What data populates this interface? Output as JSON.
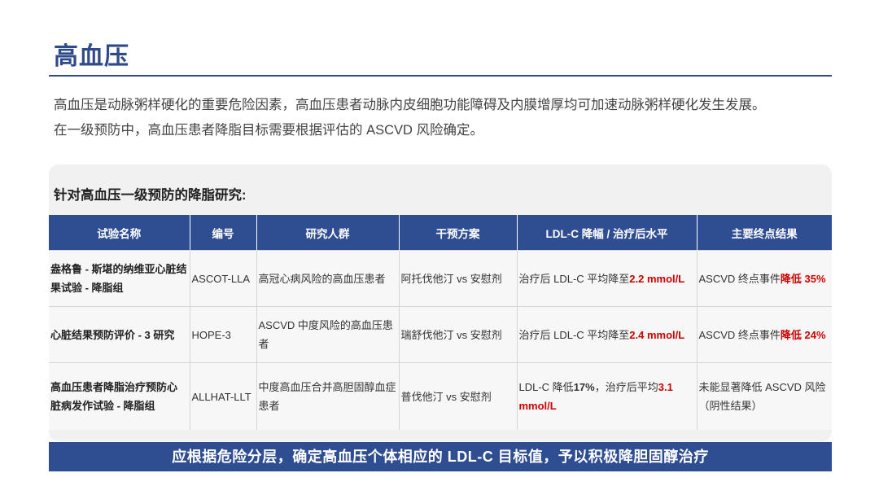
{
  "page": {
    "title": "高血压",
    "intro": [
      "高血压是动脉粥样硬化的重要危险因素，高血压患者动脉内皮细胞功能障碍及内膜增厚均可加速动脉粥样硬化发生发展。",
      "在一级预防中，高血压患者降脂目标需要根据评估的 ASCVD 风险确定。"
    ]
  },
  "panel": {
    "heading": "针对高血压一级预防的降脂研究:"
  },
  "table": {
    "headers": [
      "试验名称",
      "编号",
      "研究人群",
      "干预方案",
      "LDL-C 降幅 / 治疗后水平",
      "主要终点结果"
    ],
    "rows": [
      {
        "name": "盎格鲁 - 斯堪的纳维亚心脏结果试验 - 降脂组",
        "code": "ASCOT-LLA",
        "population": "高冠心病风险的高血压患者",
        "intervention": "阿托伐他汀 vs 安慰剂",
        "ldl_prefix": "治疗后 LDL-C 平均降至",
        "ldl_value": "2.2 mmol/L",
        "endpoint_prefix": "ASCVD 终点事件",
        "endpoint_value": "降低 35%"
      },
      {
        "name": "心脏结果预防评价 - 3 研究",
        "code": "HOPE-3",
        "population": "ASCVD 中度风险的高血压患者",
        "intervention": "瑞舒伐他汀 vs 安慰剂",
        "ldl_prefix": "治疗后 LDL-C 平均降至",
        "ldl_value": "2.4 mmol/L",
        "endpoint_prefix": "ASCVD 终点事件",
        "endpoint_value": "降低 24%"
      },
      {
        "name": "高血压患者降脂治疗预防心脏病发作试验 - 降脂组",
        "code": "ALLHAT-LLT",
        "population": "中度高血压合并高胆固醇血症患者",
        "intervention": "普伐他汀 vs 安慰剂",
        "ldl_prefix": "LDL-C 降低",
        "ldl_pct": "17%",
        "ldl_mid": "，治疗后平均",
        "ldl_value": "3.1 mmol/L",
        "endpoint_text": "未能显著降低 ASCVD 风险（阴性结果）"
      }
    ]
  },
  "banner": {
    "text": "应根据危险分层，确定高血压个体相应的 LDL-C 目标值，予以积极降胆固醇治疗"
  },
  "colors": {
    "brand_blue": "#2f4d91",
    "highlight_red": "#cc0000"
  }
}
